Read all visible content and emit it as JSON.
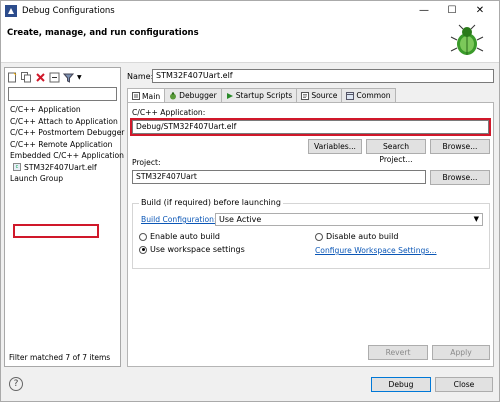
{
  "window": {
    "title": "Debug Configurations",
    "banner_title": "Create, manage, and run configurations",
    "controls": [
      "minimize-icon",
      "maximize-icon",
      "close-icon"
    ]
  },
  "left_pane": {
    "toolbar_icons": [
      "new-config-icon",
      "duplicate-icon",
      "delete-icon",
      "collapse-all-icon",
      "filter-icon"
    ],
    "filter_value": "",
    "tree": [
      {
        "label": "C/C++ Application"
      },
      {
        "label": "C/C++ Attach to Application"
      },
      {
        "label": "C/C++ Postmortem Debugger"
      },
      {
        "label": "C/C++ Remote Application"
      },
      {
        "label": "Embedded C/C++ Application"
      },
      {
        "label": "STM32F407Uart.elf",
        "selected": true
      },
      {
        "label": "Launch Group"
      }
    ],
    "status": "Filter matched 7 of 7 items"
  },
  "right_pane": {
    "name_label": "Name:",
    "name_value": "STM32F407Uart.elf",
    "tabs": [
      {
        "label": "Main",
        "icon": "main-tab-icon",
        "active": true
      },
      {
        "label": "Debugger",
        "icon": "debugger-icon"
      },
      {
        "label": "Startup Scripts",
        "icon": "startup-icon"
      },
      {
        "label": "Source",
        "icon": "source-icon"
      },
      {
        "label": "Common",
        "icon": "common-icon"
      }
    ],
    "main": {
      "app_label": "C/C++ Application:",
      "app_value": "Debug/STM32F407Uart.elf",
      "variables_btn": "Variables...",
      "search_btn": "Search Project...",
      "browse_btn": "Browse...",
      "project_label": "Project:",
      "project_value": "STM32F407Uart",
      "project_browse_btn": "Browse...",
      "build_group_title": "Build (if required) before launching",
      "build_config_label": "Build Configuration:",
      "build_config_value": "Use Active",
      "radio_enable": "Enable auto build",
      "radio_disable": "Disable auto build",
      "radio_workspace": "Use workspace settings",
      "configure_link": "Configure Workspace Settings...",
      "selected_build_option": "Use workspace settings"
    },
    "revert_btn": "Revert",
    "apply_btn": "Apply"
  },
  "footer": {
    "help_icon": "help-icon",
    "debug_btn": "Debug",
    "close_btn": "Close"
  },
  "colors": {
    "highlight_red": "#d0182a",
    "link_blue": "#0a56b6"
  }
}
